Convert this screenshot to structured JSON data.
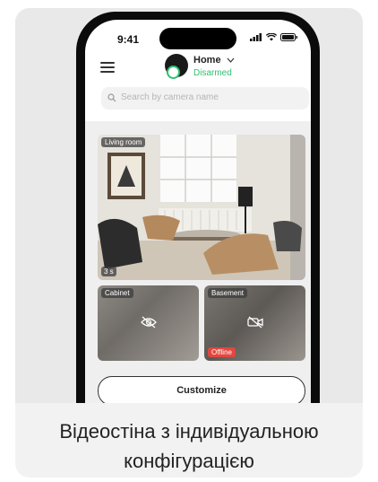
{
  "status_bar": {
    "time": "9:41"
  },
  "header": {
    "hub_name": "Home",
    "hub_state": "Disarmed",
    "colors": {
      "disarmed": "#2fbf71"
    }
  },
  "search": {
    "placeholder": "Search by camera name"
  },
  "cameras": [
    {
      "label": "Living room",
      "timer": "3 s"
    },
    {
      "label": "Cabinet",
      "icon": "eye-off-icon"
    },
    {
      "label": "Basement",
      "icon": "camera-off-icon",
      "status": "Offline"
    }
  ],
  "actions": {
    "customize_label": "Customize"
  },
  "caption": {
    "line1": "Відеостіна з індивідуальною",
    "line2": "конфігурацією"
  },
  "colors": {
    "offline": "#e2473f"
  }
}
